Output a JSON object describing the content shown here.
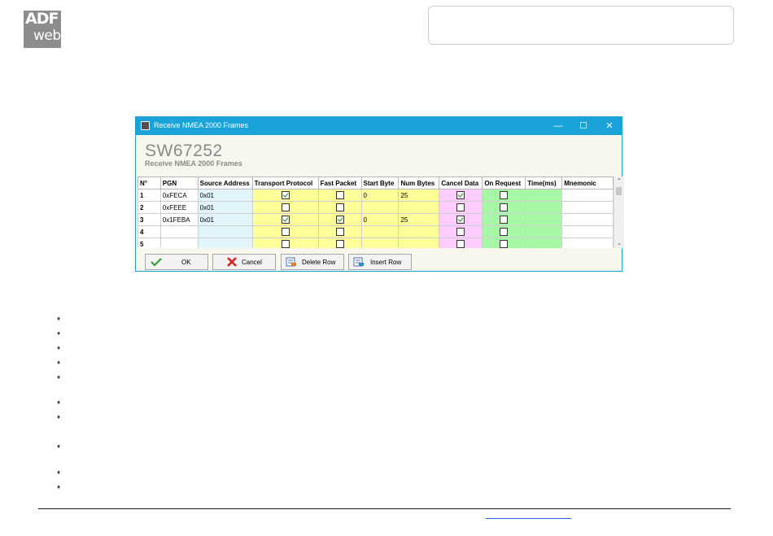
{
  "logo": {
    "line1": "ADF",
    "line2": "web"
  },
  "window": {
    "title": "Receive NMEA 2000 Frames",
    "controls": {
      "minimize": "—",
      "maximize": "☐",
      "close": "✕"
    },
    "model": "SW67252",
    "subtitle": "Receive NMEA 2000 Frames"
  },
  "table": {
    "columns": [
      "N°",
      "PGN",
      "Source Address",
      "Transport Protocol",
      "Fast Packet",
      "Start Byte",
      "Num Bytes",
      "Cancel Data",
      "On Request",
      "Time(ms)",
      "Mnemonic"
    ],
    "rows": [
      {
        "n": "1",
        "pgn": "0xFECA",
        "src": "0x01",
        "tp": true,
        "fp": false,
        "start": "0",
        "num": "25",
        "cancel": true,
        "onreq": false,
        "time": "",
        "mnem": ""
      },
      {
        "n": "2",
        "pgn": "0xFEEE",
        "src": "0x01",
        "tp": false,
        "fp": false,
        "start": "",
        "num": "",
        "cancel": false,
        "onreq": false,
        "time": "",
        "mnem": ""
      },
      {
        "n": "3",
        "pgn": "0x1FEBA",
        "src": "0x01",
        "tp": true,
        "fp": true,
        "start": "0",
        "num": "25",
        "cancel": true,
        "onreq": false,
        "time": "",
        "mnem": ""
      },
      {
        "n": "4",
        "pgn": "",
        "src": "",
        "tp": false,
        "fp": false,
        "start": "",
        "num": "",
        "cancel": false,
        "onreq": false,
        "time": "",
        "mnem": ""
      },
      {
        "n": "5",
        "pgn": "",
        "src": "",
        "tp": false,
        "fp": false,
        "start": "",
        "num": "",
        "cancel": false,
        "onreq": false,
        "time": "",
        "mnem": ""
      }
    ]
  },
  "buttons": {
    "ok": "OK",
    "cancel": "Cancel",
    "delete_row": "Delete Row",
    "insert_row": "Insert Row"
  },
  "bullet_glyph": "♦",
  "colors": {
    "titlebar": "#1aa3d8",
    "transport": "#ffff99",
    "cancel_data": "#ffccff",
    "time": "#a6f7a6",
    "source": "#e1f5fa"
  }
}
